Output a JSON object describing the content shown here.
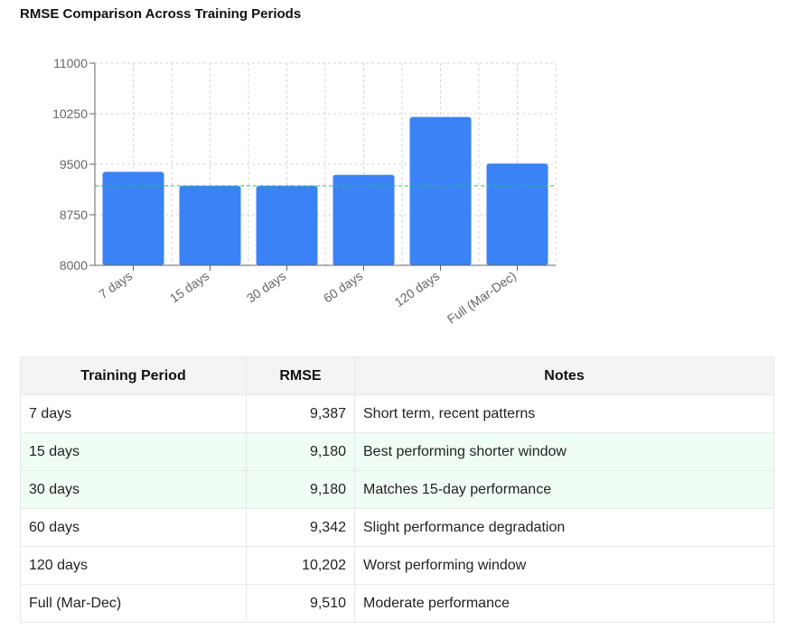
{
  "title": "RMSE Comparison Across Training Periods",
  "chart_data": {
    "type": "bar",
    "categories": [
      "7 days",
      "15 days",
      "30 days",
      "60 days",
      "120 days",
      "Full (Mar-Dec)"
    ],
    "values": [
      9387,
      9180,
      9180,
      9342,
      10202,
      9510
    ],
    "ylim": [
      8000,
      11000
    ],
    "yticks": [
      8000,
      8750,
      9500,
      10250,
      11000
    ],
    "reference_line": 9180,
    "grid": true,
    "colors": {
      "bar": "#3b82f6",
      "reference": "#22c55e"
    }
  },
  "table": {
    "headers": [
      "Training Period",
      "RMSE",
      "Notes"
    ],
    "rows": [
      {
        "period": "7 days",
        "rmse": "9,387",
        "notes": "Short term, recent patterns",
        "highlight": false
      },
      {
        "period": "15 days",
        "rmse": "9,180",
        "notes": "Best performing shorter window",
        "highlight": true
      },
      {
        "period": "30 days",
        "rmse": "9,180",
        "notes": "Matches 15-day performance",
        "highlight": true
      },
      {
        "period": "60 days",
        "rmse": "9,342",
        "notes": "Slight performance degradation",
        "highlight": false
      },
      {
        "period": "120 days",
        "rmse": "10,202",
        "notes": "Worst performing window",
        "highlight": false
      },
      {
        "period": "Full (Mar-Dec)",
        "rmse": "9,510",
        "notes": "Moderate performance",
        "highlight": false
      }
    ]
  }
}
